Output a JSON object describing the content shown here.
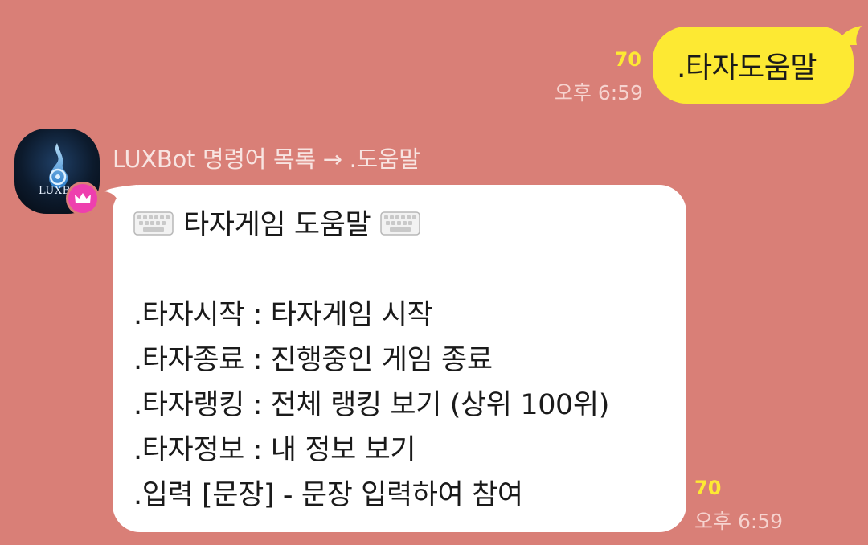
{
  "outgoing": {
    "text": ".타자도움말",
    "unread_count": "70",
    "time": "오후 6:59"
  },
  "incoming": {
    "avatar_label": "LUXBot",
    "sender_name": "LUXBot 명령어 목록 → .도움말",
    "header_title": "타자게임 도움말",
    "header_icon": "keyboard-icon",
    "lines": [
      ".타자시작 : 타자게임 시작",
      ".타자종료 : 진행중인 게임 종료",
      ".타자랭킹 : 전체 랭킹 보기 (상위 100위)",
      ".타자정보 : 내 정보 보기",
      ".입력 [문장] - 문장 입력하여 참여"
    ],
    "unread_count": "70",
    "time": "오후 6:59",
    "badge_icon": "crown-icon"
  },
  "colors": {
    "background": "#d97f77",
    "outgoing_bubble": "#fde933",
    "incoming_bubble": "#ffffff",
    "unread": "#fde933",
    "badge": "#ee3fae"
  }
}
